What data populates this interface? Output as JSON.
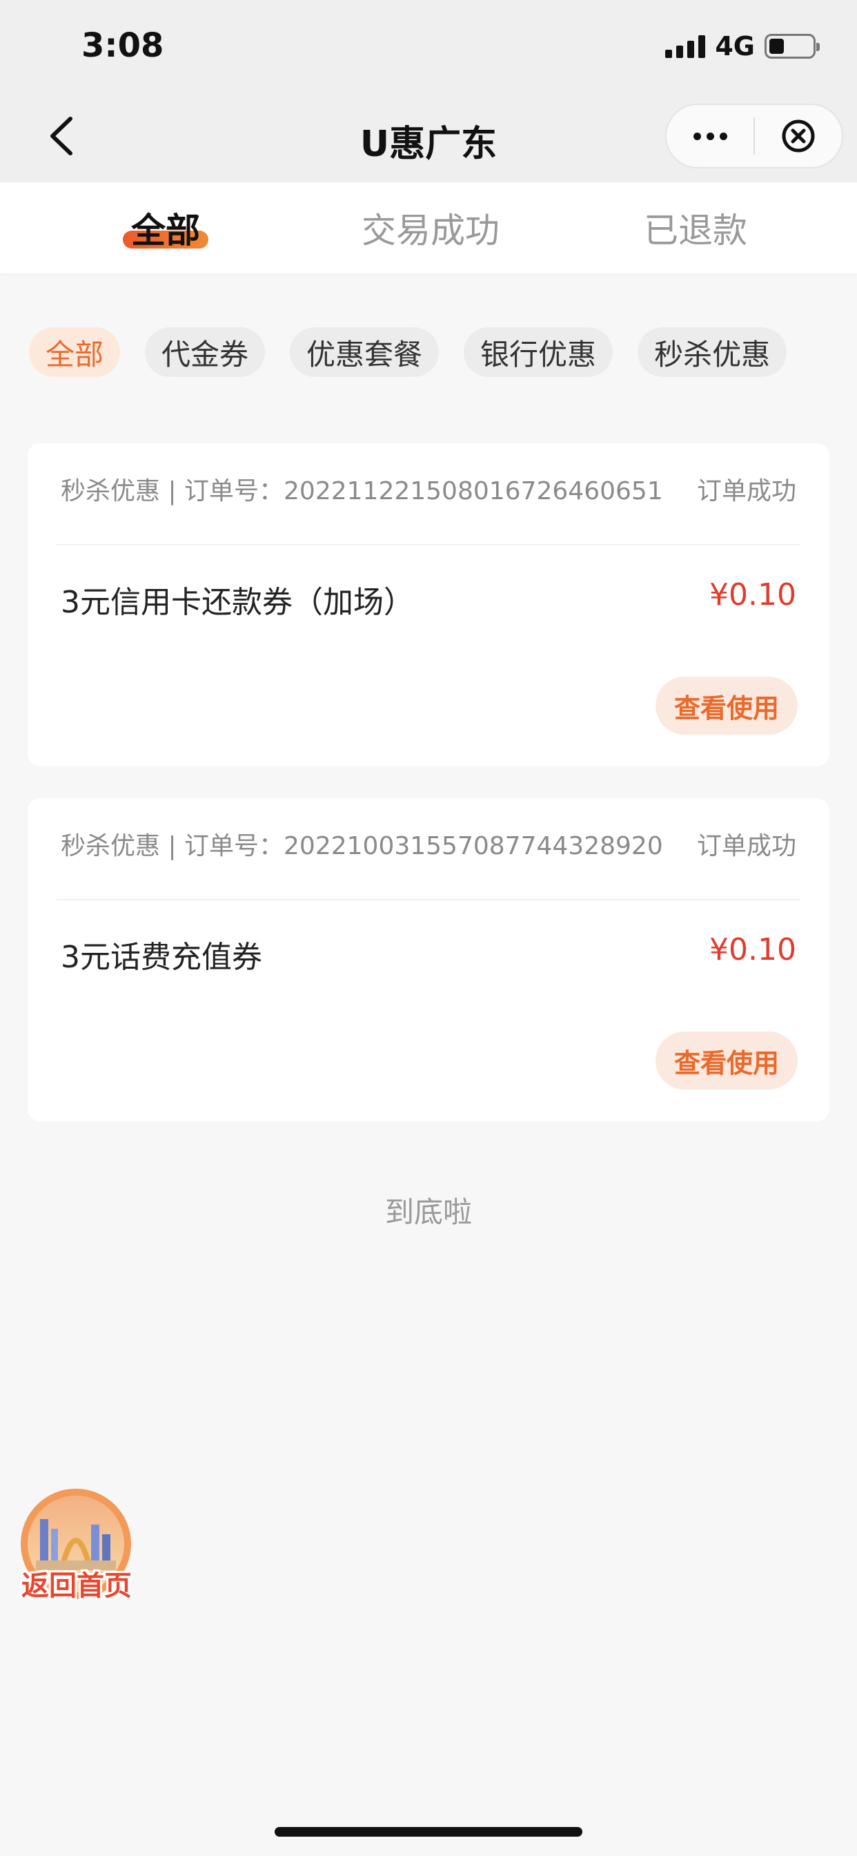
{
  "status_bar": {
    "time": "3:08",
    "network": "4G",
    "battery_level": 0.35
  },
  "nav": {
    "title": "U惠广东",
    "back_icon": "chevron-left-icon",
    "more_icon": "more-dots-icon",
    "close_icon": "circle-close-icon"
  },
  "main_tabs": [
    {
      "label": "全部",
      "active": true
    },
    {
      "label": "交易成功",
      "active": false
    },
    {
      "label": "已退款",
      "active": false
    }
  ],
  "filters": [
    {
      "label": "全部",
      "active": true
    },
    {
      "label": "代金券",
      "active": false
    },
    {
      "label": "优惠套餐",
      "active": false
    },
    {
      "label": "银行优惠",
      "active": false
    },
    {
      "label": "秒杀优惠",
      "active": false
    }
  ],
  "orders": [
    {
      "meta": "秒杀优惠 | 订单号：20221122150801672646065​1",
      "status": "订单成功",
      "name": "3元信用卡还款券（加场）",
      "price": "¥0.10",
      "action": "查看使用"
    },
    {
      "meta": "秒杀优惠 | 订单号：20221003155708774432892​0",
      "status": "订单成功",
      "name": "3元话费充值券",
      "price": "¥0.10",
      "action": "查看使用"
    }
  ],
  "end_text": "到底啦",
  "home_badge": {
    "label": "返回首页"
  },
  "colors": {
    "accent": "#ea6a2c",
    "price": "#e13b2e",
    "chip_active_bg": "#fce9dc"
  }
}
